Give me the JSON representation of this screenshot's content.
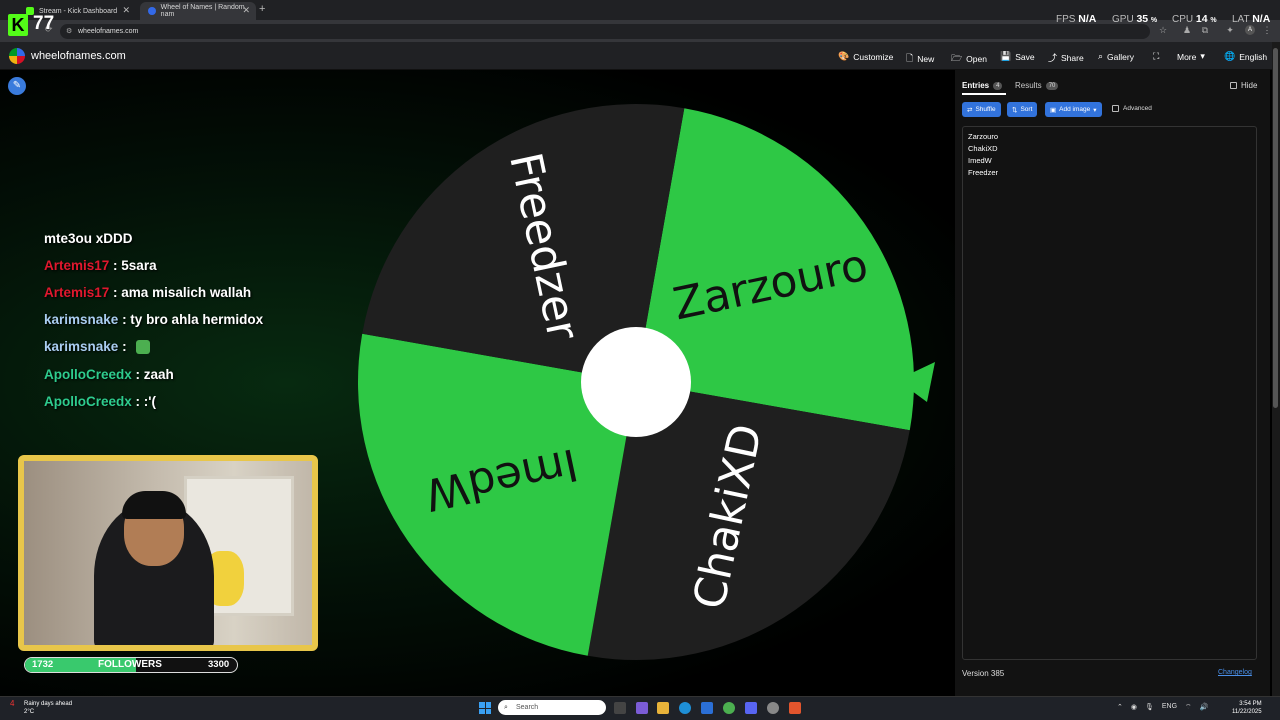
{
  "browser": {
    "tabs": [
      {
        "title": "Stream - Kick Dashboard",
        "favicon_color": "#53fc18"
      },
      {
        "title": "Wheel of Names | Random nam",
        "favicon_color": "#3369e8"
      }
    ],
    "address": "wheelofnames.com"
  },
  "overlay": {
    "kick_count": "77",
    "stats": [
      {
        "label": "FPS",
        "value": "N/A",
        "unit": ""
      },
      {
        "label": "GPU",
        "value": "35",
        "unit": "%"
      },
      {
        "label": "CPU",
        "value": "14",
        "unit": "%"
      },
      {
        "label": "LAT",
        "value": "N/A",
        "unit": ""
      }
    ]
  },
  "site": {
    "name": "wheelofnames.com",
    "menu": {
      "customize": "Customize",
      "new": "New",
      "open": "Open",
      "save": "Save",
      "share": "Share",
      "gallery": "Gallery",
      "more": "More",
      "language": "English"
    }
  },
  "chat": [
    {
      "user": "",
      "message": "mte3ou xDDD",
      "color": "#ffffff"
    },
    {
      "user": "Artemis17",
      "message": " : 5sara",
      "color": "#e0182e"
    },
    {
      "user": "Artemis17",
      "message": " : ama misalich wallah",
      "color": "#e0182e"
    },
    {
      "user": "karimsnake",
      "message": " : ty bro ahla hermidox",
      "color": "#a9cdf0"
    },
    {
      "user": "karimsnake",
      "message": " : ",
      "color": "#a9cdf0"
    },
    {
      "user": "ApolloCreedx",
      "message": " : zaah",
      "color": "#2ecc8e"
    },
    {
      "user": "ApolloCreedx",
      "message": " : :'(",
      "color": "#2ecc8e"
    }
  ],
  "followers": {
    "current": "1732",
    "label": "FOLLOWERS",
    "goal": "3300",
    "progress": 0.525
  },
  "wheel": {
    "segments": [
      {
        "name": "Zarzouro",
        "color": "#2ec845"
      },
      {
        "name": "ChakiXD",
        "color": "#1f1f1f"
      },
      {
        "name": "ImedW",
        "color": "#2ec845"
      },
      {
        "name": "Freedzer",
        "color": "#1f1f1f"
      }
    ],
    "pointer_color": "#2ec845"
  },
  "panel": {
    "tabs": {
      "entries": "Entries",
      "entries_count": "4",
      "results": "Results",
      "results_count": "70"
    },
    "hide": "Hide",
    "shuffle": "Shuffle",
    "sort": "Sort",
    "add_image": "Add image",
    "advanced": "Advanced",
    "entries": [
      "Zarzouro",
      "ChakiXD",
      "ImedW",
      "Freedzer"
    ],
    "version": "Version 385",
    "changelog": "Changelog"
  },
  "taskbar": {
    "weather_line1": "Rainy days ahead",
    "weather_line2": "2°C",
    "weather_badge": "4",
    "search": "Search",
    "lang": "ENG",
    "time": "3:54 PM",
    "date": "11/22/2025"
  }
}
